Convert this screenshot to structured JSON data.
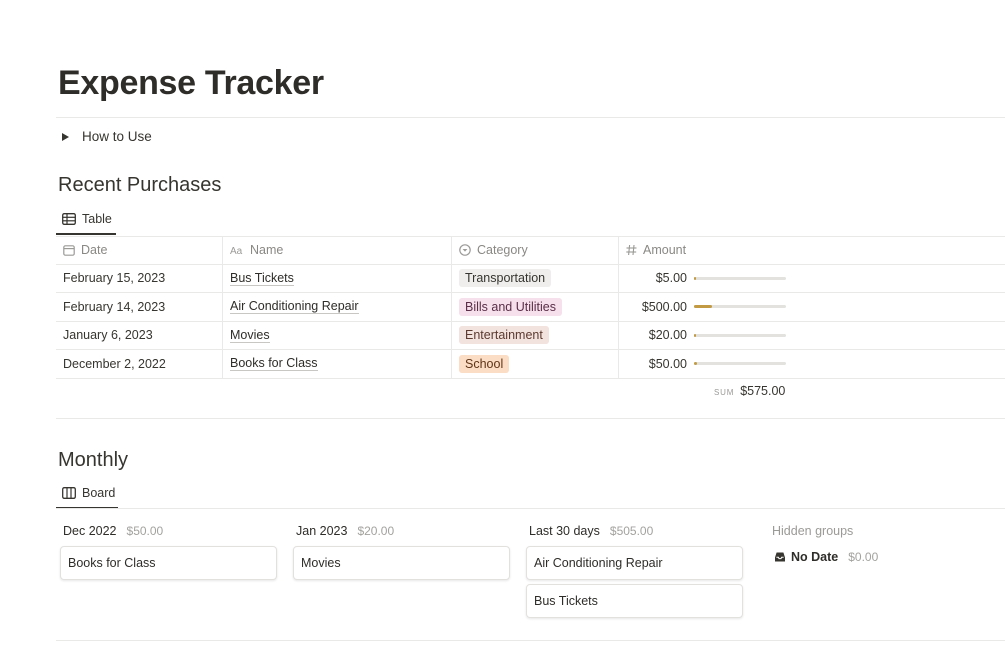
{
  "page": {
    "title": "Expense Tracker"
  },
  "how_to_use": {
    "label": "How to Use"
  },
  "recent": {
    "heading": "Recent Purchases",
    "view_tab": "Table",
    "columns": {
      "date": "Date",
      "name": "Name",
      "category": "Category",
      "amount": "Amount"
    },
    "rows": [
      {
        "date": "February 15, 2023",
        "name": "Bus Tickets",
        "category": "Transportation",
        "category_color": "#efeeec",
        "category_text": "#37352f",
        "amount": "$5.00",
        "progress": 0.01
      },
      {
        "date": "February 14, 2023",
        "name": "Air Conditioning Repair",
        "category": "Bills and Utilities",
        "category_color": "#f5e0ec",
        "category_text": "#5b2e48",
        "amount": "$500.00",
        "progress": 0.2
      },
      {
        "date": "January 6, 2023",
        "name": "Movies",
        "category": "Entertainment",
        "category_color": "#f2e3df",
        "category_text": "#5d3a2f",
        "amount": "$20.00",
        "progress": 0.02
      },
      {
        "date": "December 2, 2022",
        "name": "Books for Class",
        "category": "School",
        "category_color": "#fbdcc4",
        "category_text": "#5f3517",
        "amount": "$50.00",
        "progress": 0.03
      }
    ],
    "sum_label": "SUM",
    "sum_value": "$575.00"
  },
  "monthly": {
    "heading": "Monthly",
    "view_tab": "Board",
    "columns": [
      {
        "title": "Dec 2022",
        "count": "$50.00",
        "cards": [
          "Books for Class"
        ]
      },
      {
        "title": "Jan 2023",
        "count": "$20.00",
        "cards": [
          "Movies"
        ]
      },
      {
        "title": "Last 30 days",
        "count": "$505.00",
        "cards": [
          "Air Conditioning Repair",
          "Bus Tickets"
        ]
      }
    ],
    "hidden_groups": "Hidden groups",
    "no_date": {
      "title": "No Date",
      "count": "$0.00"
    }
  },
  "colors": {
    "accent_bar": "#c29a43",
    "text": "#37352f",
    "muted": "#9b9a97"
  }
}
